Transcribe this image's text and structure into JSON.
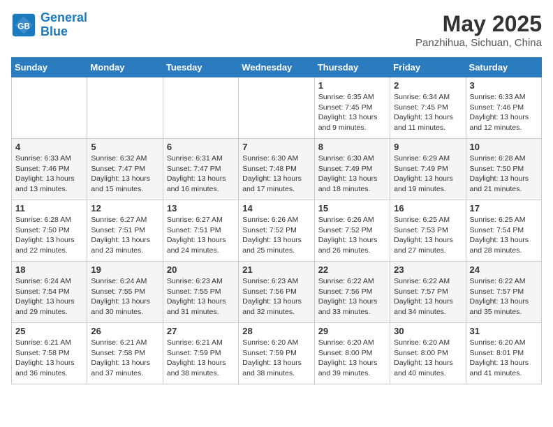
{
  "header": {
    "logo_line1": "General",
    "logo_line2": "Blue",
    "month_year": "May 2025",
    "location": "Panzhihua, Sichuan, China"
  },
  "weekdays": [
    "Sunday",
    "Monday",
    "Tuesday",
    "Wednesday",
    "Thursday",
    "Friday",
    "Saturday"
  ],
  "weeks": [
    [
      {
        "day": "",
        "info": ""
      },
      {
        "day": "",
        "info": ""
      },
      {
        "day": "",
        "info": ""
      },
      {
        "day": "",
        "info": ""
      },
      {
        "day": "1",
        "info": "Sunrise: 6:35 AM\nSunset: 7:45 PM\nDaylight: 13 hours\nand 9 minutes."
      },
      {
        "day": "2",
        "info": "Sunrise: 6:34 AM\nSunset: 7:45 PM\nDaylight: 13 hours\nand 11 minutes."
      },
      {
        "day": "3",
        "info": "Sunrise: 6:33 AM\nSunset: 7:46 PM\nDaylight: 13 hours\nand 12 minutes."
      }
    ],
    [
      {
        "day": "4",
        "info": "Sunrise: 6:33 AM\nSunset: 7:46 PM\nDaylight: 13 hours\nand 13 minutes."
      },
      {
        "day": "5",
        "info": "Sunrise: 6:32 AM\nSunset: 7:47 PM\nDaylight: 13 hours\nand 15 minutes."
      },
      {
        "day": "6",
        "info": "Sunrise: 6:31 AM\nSunset: 7:47 PM\nDaylight: 13 hours\nand 16 minutes."
      },
      {
        "day": "7",
        "info": "Sunrise: 6:30 AM\nSunset: 7:48 PM\nDaylight: 13 hours\nand 17 minutes."
      },
      {
        "day": "8",
        "info": "Sunrise: 6:30 AM\nSunset: 7:49 PM\nDaylight: 13 hours\nand 18 minutes."
      },
      {
        "day": "9",
        "info": "Sunrise: 6:29 AM\nSunset: 7:49 PM\nDaylight: 13 hours\nand 19 minutes."
      },
      {
        "day": "10",
        "info": "Sunrise: 6:28 AM\nSunset: 7:50 PM\nDaylight: 13 hours\nand 21 minutes."
      }
    ],
    [
      {
        "day": "11",
        "info": "Sunrise: 6:28 AM\nSunset: 7:50 PM\nDaylight: 13 hours\nand 22 minutes."
      },
      {
        "day": "12",
        "info": "Sunrise: 6:27 AM\nSunset: 7:51 PM\nDaylight: 13 hours\nand 23 minutes."
      },
      {
        "day": "13",
        "info": "Sunrise: 6:27 AM\nSunset: 7:51 PM\nDaylight: 13 hours\nand 24 minutes."
      },
      {
        "day": "14",
        "info": "Sunrise: 6:26 AM\nSunset: 7:52 PM\nDaylight: 13 hours\nand 25 minutes."
      },
      {
        "day": "15",
        "info": "Sunrise: 6:26 AM\nSunset: 7:52 PM\nDaylight: 13 hours\nand 26 minutes."
      },
      {
        "day": "16",
        "info": "Sunrise: 6:25 AM\nSunset: 7:53 PM\nDaylight: 13 hours\nand 27 minutes."
      },
      {
        "day": "17",
        "info": "Sunrise: 6:25 AM\nSunset: 7:54 PM\nDaylight: 13 hours\nand 28 minutes."
      }
    ],
    [
      {
        "day": "18",
        "info": "Sunrise: 6:24 AM\nSunset: 7:54 PM\nDaylight: 13 hours\nand 29 minutes."
      },
      {
        "day": "19",
        "info": "Sunrise: 6:24 AM\nSunset: 7:55 PM\nDaylight: 13 hours\nand 30 minutes."
      },
      {
        "day": "20",
        "info": "Sunrise: 6:23 AM\nSunset: 7:55 PM\nDaylight: 13 hours\nand 31 minutes."
      },
      {
        "day": "21",
        "info": "Sunrise: 6:23 AM\nSunset: 7:56 PM\nDaylight: 13 hours\nand 32 minutes."
      },
      {
        "day": "22",
        "info": "Sunrise: 6:22 AM\nSunset: 7:56 PM\nDaylight: 13 hours\nand 33 minutes."
      },
      {
        "day": "23",
        "info": "Sunrise: 6:22 AM\nSunset: 7:57 PM\nDaylight: 13 hours\nand 34 minutes."
      },
      {
        "day": "24",
        "info": "Sunrise: 6:22 AM\nSunset: 7:57 PM\nDaylight: 13 hours\nand 35 minutes."
      }
    ],
    [
      {
        "day": "25",
        "info": "Sunrise: 6:21 AM\nSunset: 7:58 PM\nDaylight: 13 hours\nand 36 minutes."
      },
      {
        "day": "26",
        "info": "Sunrise: 6:21 AM\nSunset: 7:58 PM\nDaylight: 13 hours\nand 37 minutes."
      },
      {
        "day": "27",
        "info": "Sunrise: 6:21 AM\nSunset: 7:59 PM\nDaylight: 13 hours\nand 38 minutes."
      },
      {
        "day": "28",
        "info": "Sunrise: 6:20 AM\nSunset: 7:59 PM\nDaylight: 13 hours\nand 38 minutes."
      },
      {
        "day": "29",
        "info": "Sunrise: 6:20 AM\nSunset: 8:00 PM\nDaylight: 13 hours\nand 39 minutes."
      },
      {
        "day": "30",
        "info": "Sunrise: 6:20 AM\nSunset: 8:00 PM\nDaylight: 13 hours\nand 40 minutes."
      },
      {
        "day": "31",
        "info": "Sunrise: 6:20 AM\nSunset: 8:01 PM\nDaylight: 13 hours\nand 41 minutes."
      }
    ]
  ]
}
